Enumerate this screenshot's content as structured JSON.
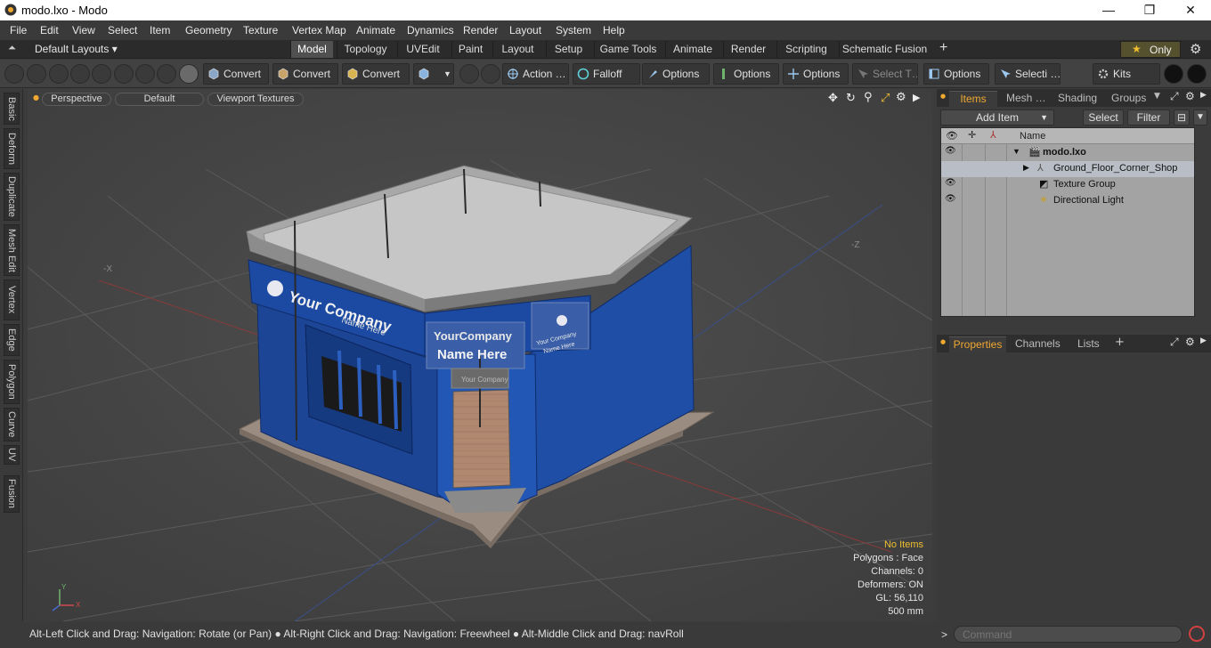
{
  "window": {
    "title": "modo.lxo - Modo",
    "minimize": "—",
    "maximize": "❐",
    "close": "✕"
  },
  "menu": [
    "File",
    "Edit",
    "View",
    "Select",
    "Item",
    "Geometry",
    "Texture",
    "Vertex Map",
    "Animate",
    "Dynamics",
    "Render",
    "Layout",
    "System",
    "Help"
  ],
  "layout": {
    "selector": "Default Layouts ▾",
    "tabs": [
      "Model",
      "Topology",
      "UVEdit",
      "Paint",
      "Layout",
      "Setup",
      "Game Tools",
      "Animate",
      "Render",
      "Scripting",
      "Schematic Fusion"
    ],
    "active_tab": "Model",
    "add": "+",
    "only_label": "Only",
    "star": "★"
  },
  "toolbar": {
    "convert1": "Convert",
    "convert2": "Convert",
    "convert3": "Convert",
    "action": "Action …",
    "falloff": "Falloff",
    "options1": "Options",
    "options2": "Options",
    "options3": "Options",
    "select_t": "Select T…",
    "options4": "Options",
    "selecti": "Selecti …",
    "kits": "Kits"
  },
  "left_tabs": [
    "Basic",
    "Deform",
    "Duplicate",
    "Mesh Edit",
    "Vertex",
    "Edge",
    "Polygon",
    "Curve",
    "UV",
    "Fusion"
  ],
  "viewport": {
    "perspective": "Perspective",
    "default": "Default",
    "textures": "Viewport Textures",
    "axis_neg_x": "-X",
    "axis_neg_z": "-Z",
    "sign": {
      "line1": "Your Company",
      "line2": "Name Here",
      "box1": "YourCompany",
      "box2": "Name Here",
      "small1": "Your Company",
      "small2": "Name Here",
      "door": "Your Company"
    },
    "info": {
      "no_items": "No Items",
      "polygons": "Polygons : Face",
      "channels": "Channels: 0",
      "deformers": "Deformers: ON",
      "gl": "GL: 56,110",
      "scale": "500 mm"
    }
  },
  "status": {
    "hint": "Alt-Left Click and Drag: Navigation: Rotate (or Pan) ● Alt-Right Click and Drag: Navigation: Freewheel ● Alt-Middle Click and Drag: navRoll",
    "prompt": ">",
    "command_placeholder": "Command"
  },
  "items_panel": {
    "tabs": [
      "Items",
      "Mesh …",
      "Shading",
      "Groups"
    ],
    "active": "Items",
    "add_item": "Add Item",
    "select": "Select",
    "filter": "Filter",
    "col_name": "Name",
    "rows": [
      {
        "label": "modo.lxo",
        "bold": true
      },
      {
        "label": "Ground_Floor_Corner_Shop"
      },
      {
        "label": "Texture Group"
      },
      {
        "label": "Directional Light"
      }
    ]
  },
  "props_panel": {
    "tabs": [
      "Properties",
      "Channels",
      "Lists"
    ],
    "active": "Properties",
    "add": "+"
  },
  "colors": {
    "accent": "#f0a830",
    "shop_blue": "#1e4fa8"
  }
}
